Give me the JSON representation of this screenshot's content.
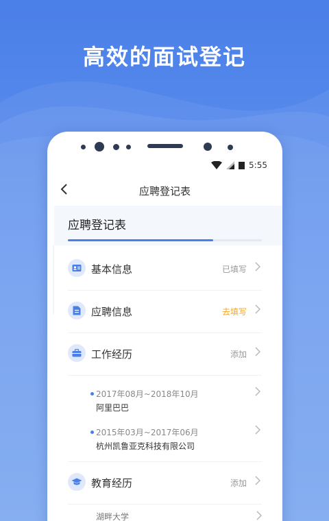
{
  "hero": {
    "title": "高效的面试登记"
  },
  "statusbar": {
    "time": "5:55"
  },
  "navbar": {
    "back_icon": "chevron-left-icon",
    "title": "应聘登记表"
  },
  "form": {
    "title": "应聘登记表",
    "progress": 0.75
  },
  "sections": [
    {
      "label": "基本信息",
      "status": "已填写",
      "icon": "id-card-icon"
    },
    {
      "label": "应聘信息",
      "status": "去填写",
      "icon": "document-icon",
      "status_color": "#f5a623"
    },
    {
      "label": "工作经历",
      "status": "添加",
      "icon": "briefcase-icon"
    },
    {
      "label": "教育经历",
      "status": "添加",
      "icon": "graduation-cap-icon"
    }
  ],
  "work_entries": [
    {
      "period": "2017年08月~2018年10月",
      "company": "阿里巴巴"
    },
    {
      "period": "2015年03月~2017年06月",
      "company": "杭州凯鲁亚克科技有限公司"
    }
  ],
  "education_entries": [
    {
      "school": "湖畔大学"
    }
  ],
  "colors": {
    "accent": "#4a7fe8",
    "warning": "#f5a623",
    "background": "#5b8fee"
  }
}
